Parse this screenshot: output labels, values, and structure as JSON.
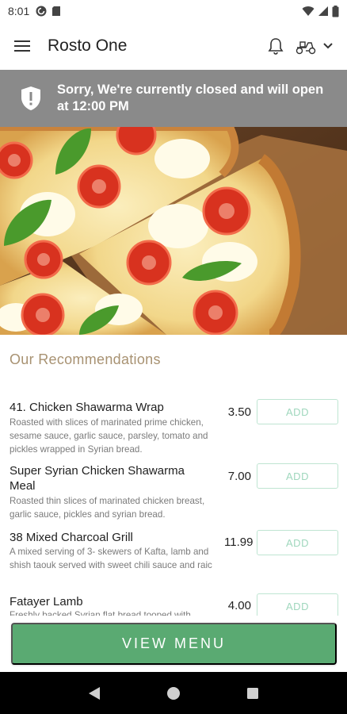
{
  "status_bar": {
    "time": "8:01",
    "icons_left": [
      "pocket-casts-icon",
      "sd-card-icon"
    ],
    "icons_right": [
      "wifi-icon",
      "signal-icon",
      "battery-icon"
    ]
  },
  "app_bar": {
    "menu_icon": "hamburger-menu-icon",
    "title": "Rosto One",
    "bell_icon": "bell-icon",
    "delivery_icon": "scooter-icon",
    "dropdown_icon": "chevron-down-icon"
  },
  "closed_banner": {
    "icon": "shield-alert-icon",
    "message": "Sorry, We're currently closed and will open at 12:00 PM",
    "color": "#8a8a8a"
  },
  "hero": {
    "description_icon": "pizza-image"
  },
  "recommendations": {
    "title": "Our Recommendations",
    "add_label": "ADD",
    "items": [
      {
        "name": "41. Chicken Shawarma Wrap",
        "description": "Roasted with slices of marinated prime chicken, sesame sauce, garlic sauce, parsley, tomato and pickles wrapped in Syrian bread.",
        "price": "3.50"
      },
      {
        "name": "Super Syrian Chicken Shawarma Meal",
        "description": "Roasted thin slices of marinated chicken breast, garlic sauce, pickles and syrian bread.",
        "price": "7.00"
      },
      {
        "name": "38 Mixed Charcoal Grill",
        "description": "A mixed serving of 3- skewers of Kafta, lamb and shish taouk served with sweet chili sauce and raic",
        "price": "11.99"
      },
      {
        "name": "Fatayer Lamb",
        "description": "Freshly backed Syrian flat bread tooped with",
        "price": "4.00"
      }
    ]
  },
  "view_menu": {
    "label": "VIEW MENU",
    "color": "#5aaa72"
  },
  "nav_bar": {
    "back_icon": "back-triangle-icon",
    "home_icon": "home-circle-icon",
    "recents_icon": "recents-square-icon"
  },
  "colors": {
    "accent_green": "#5aaa72",
    "add_border": "#bfe5d2",
    "section_title": "#a89272",
    "banner_gray": "#8a8a8a"
  }
}
